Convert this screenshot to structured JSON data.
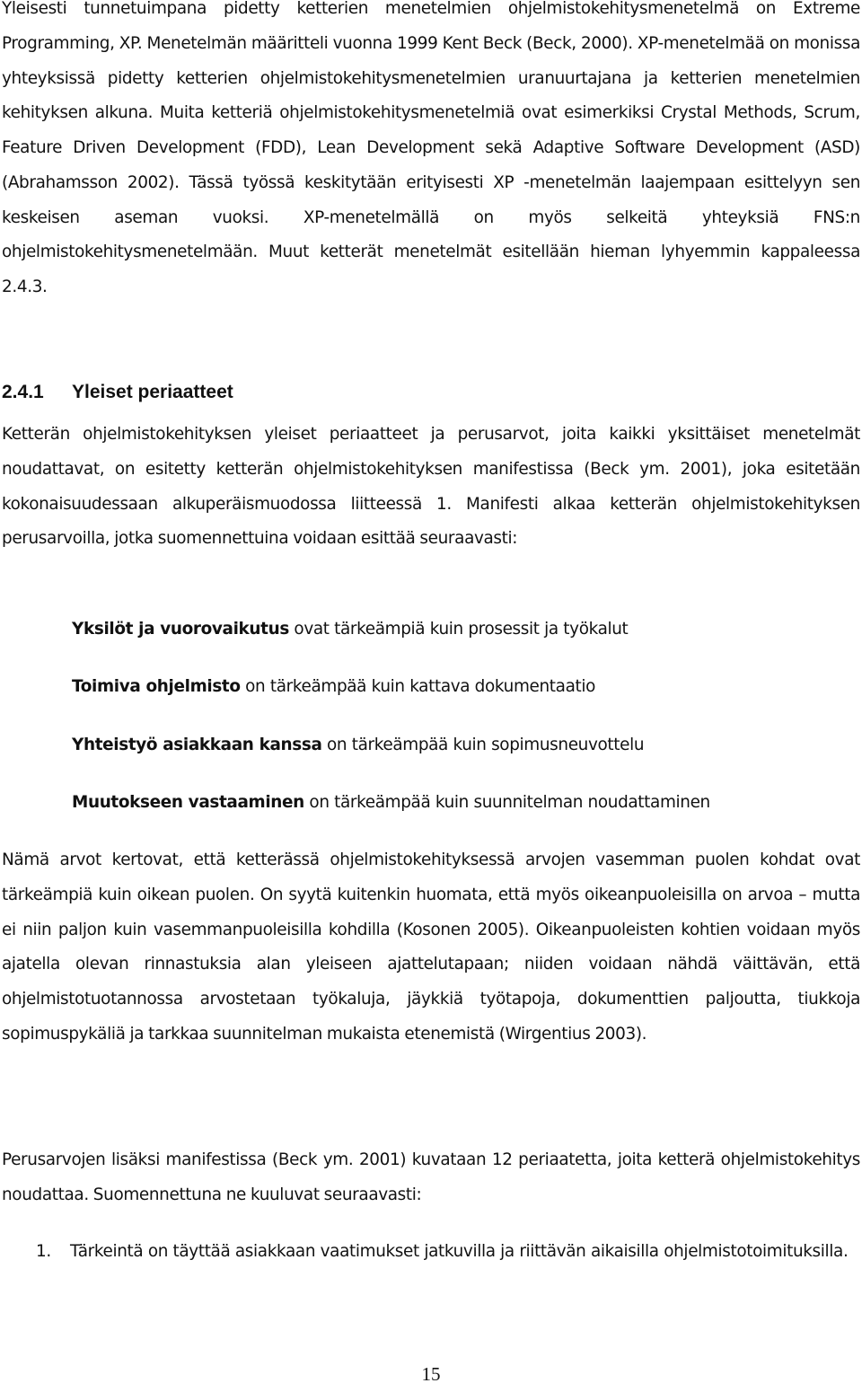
{
  "document": {
    "paragraphs": {
      "intro": "Yleisesti tunnetuimpana pidetty ketterien menetelmien ohjelmistokehitysmenetelmä on Extreme Programming, XP. Menetelmän määritteli vuonna 1999 Kent Beck (Beck, 2000). XP-menetelmää on monissa yhteyksissä pidetty ketterien ohjelmistokehitysmenetelmien uranuurtajana ja ketterien menetelmien kehityksen alkuna. Muita ketteriä ohjelmistokehitysmenetelmiä ovat esimerkiksi Crystal Methods, Scrum, Feature Driven Development (FDD), Lean Development sekä Adaptive Software Development (ASD) (Abrahamsson 2002). Tässä työssä keskitytään erityisesti XP -menetelmän laajempaan esittelyyn sen keskeisen aseman vuoksi. XP-menetelmällä on myös selkeitä yhteyksiä FNS:n ohjelmistokehitysmenetelmään. Muut ketterät menetelmät esitellään hieman lyhyemmin kappaleessa 2.4.3.",
      "principles_intro": "Ketterän ohjelmistokehityksen yleiset periaatteet ja perusarvot, joita kaikki yksittäiset menetelmät noudattavat, on esitetty ketterän ohjelmistokehityksen manifestissa (Beck ym. 2001), joka esitetään kokonaisuudessaan alkuperäismuodossa liitteessä 1. Manifesti alkaa ketterän ohjelmistokehityksen perusarvoilla, jotka suomennettuina voidaan esittää seuraavasti:",
      "values_explanation": "Nämä arvot kertovat, että ketterässä ohjelmistokehityksessä arvojen vasemman puolen kohdat ovat tärkeämpiä kuin oikean puolen. On syytä kuitenkin huomata, että myös oikeanpuoleisilla on arvoa – mutta ei niin paljon kuin vasemmanpuoleisilla kohdilla (Kosonen 2005).  Oikeanpuoleisten kohtien voidaan myös ajatella olevan rinnastuksia alan yleiseen ajattelutapaan; niiden voidaan nähdä väittävän, että ohjelmistotuotannossa arvostetaan työkaluja, jäykkiä työtapoja, dokumenttien paljoutta, tiukkoja sopimuspykäliä ja tarkkaa suunnitelman mukaista etenemistä (Wirgentius 2003).",
      "twelve_principles_intro": "Perusarvojen lisäksi manifestissa (Beck ym. 2001) kuvataan 12 periaatetta, joita ketterä ohjelmistokehitys noudattaa. Suomennettuna ne kuuluvat seuraavasti:"
    },
    "section_heading": {
      "number": "2.4.1",
      "title": "Yleiset periaatteet"
    },
    "values": [
      {
        "bold": "Yksilöt ja vuorovaikutus",
        "rest": " ovat tärkeämpiä kuin prosessit ja työkalut"
      },
      {
        "bold": "Toimiva ohjelmisto",
        "rest": " on tärkeämpää kuin kattava dokumentaatio"
      },
      {
        "bold": "Yhteistyö asiakkaan kanssa",
        "rest": " on tärkeämpää kuin sopimusneuvottelu"
      },
      {
        "bold": "Muutokseen vastaaminen",
        "rest": " on tärkeämpää kuin suunnitelman noudattaminen"
      }
    ],
    "principles": [
      {
        "marker": "1.",
        "text": "Tärkeintä on täyttää asiakkaan vaatimukset jatkuvilla ja riittävän aikaisilla ohjelmistotoimituksilla."
      }
    ],
    "page_number": "15"
  }
}
